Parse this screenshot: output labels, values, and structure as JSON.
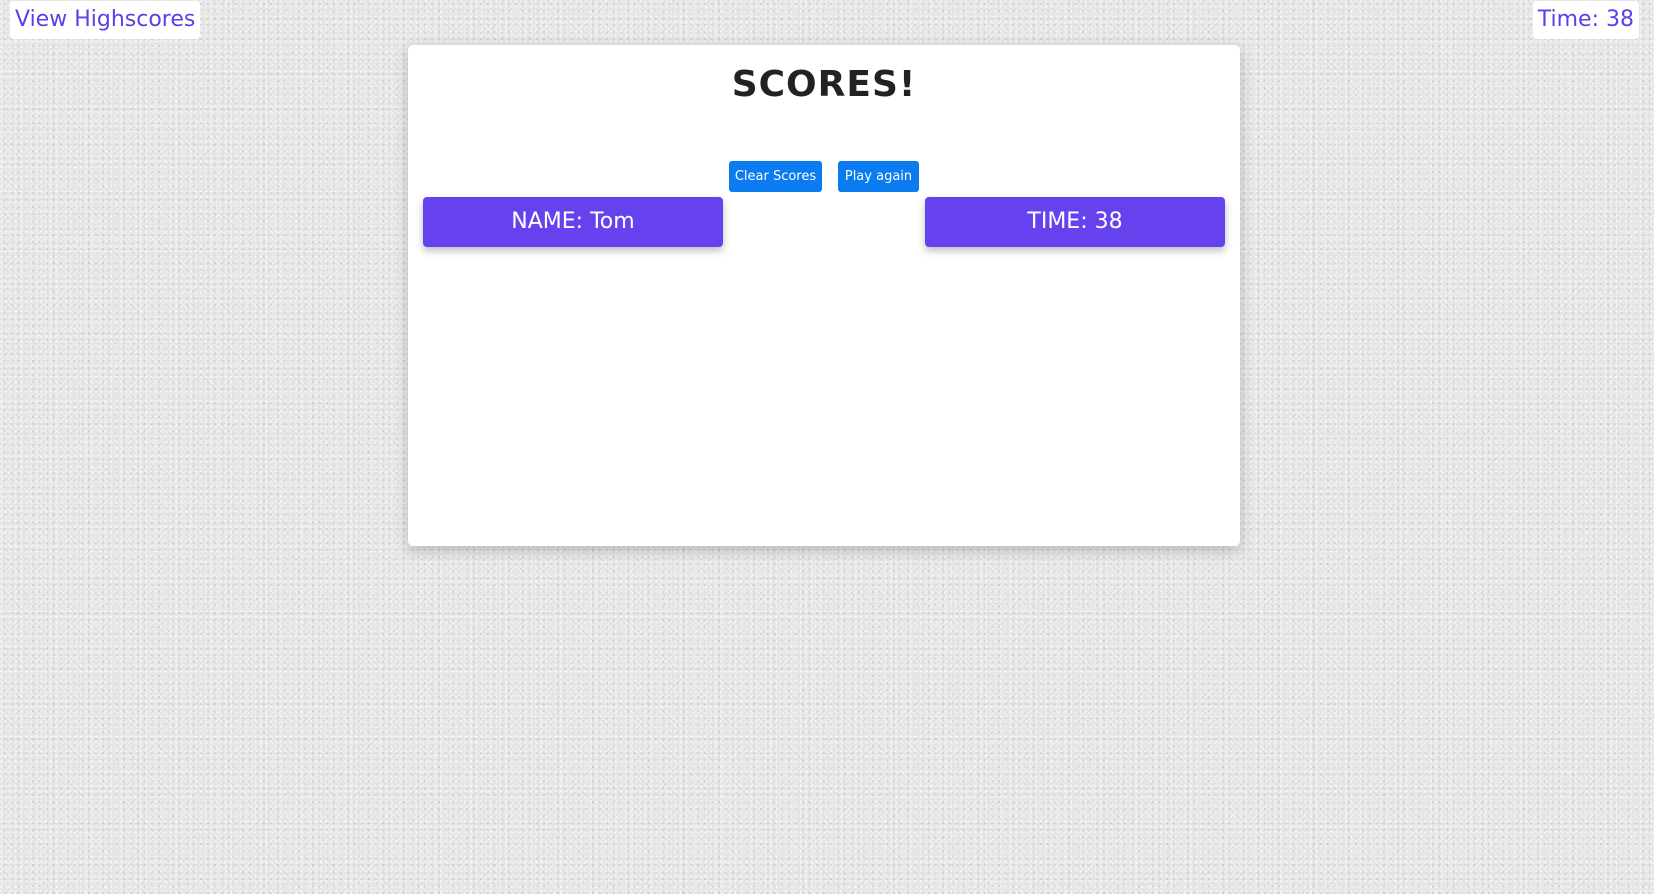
{
  "header": {
    "view_highscores_label": "View Highscores",
    "timer_text": "Time: 38"
  },
  "card": {
    "title": "SCORES!",
    "buttons": {
      "clear_label": "Clear Scores",
      "play_again_label": "Play again"
    },
    "scores": [
      {
        "name_text": "NAME: Tom",
        "time_text": "TIME: 38"
      }
    ]
  },
  "colors": {
    "accent": "#6542ee",
    "link_text": "#5b3fe8",
    "button_primary": "#0a7cf0",
    "background": "#e6e6e6",
    "card": "#ffffff"
  }
}
